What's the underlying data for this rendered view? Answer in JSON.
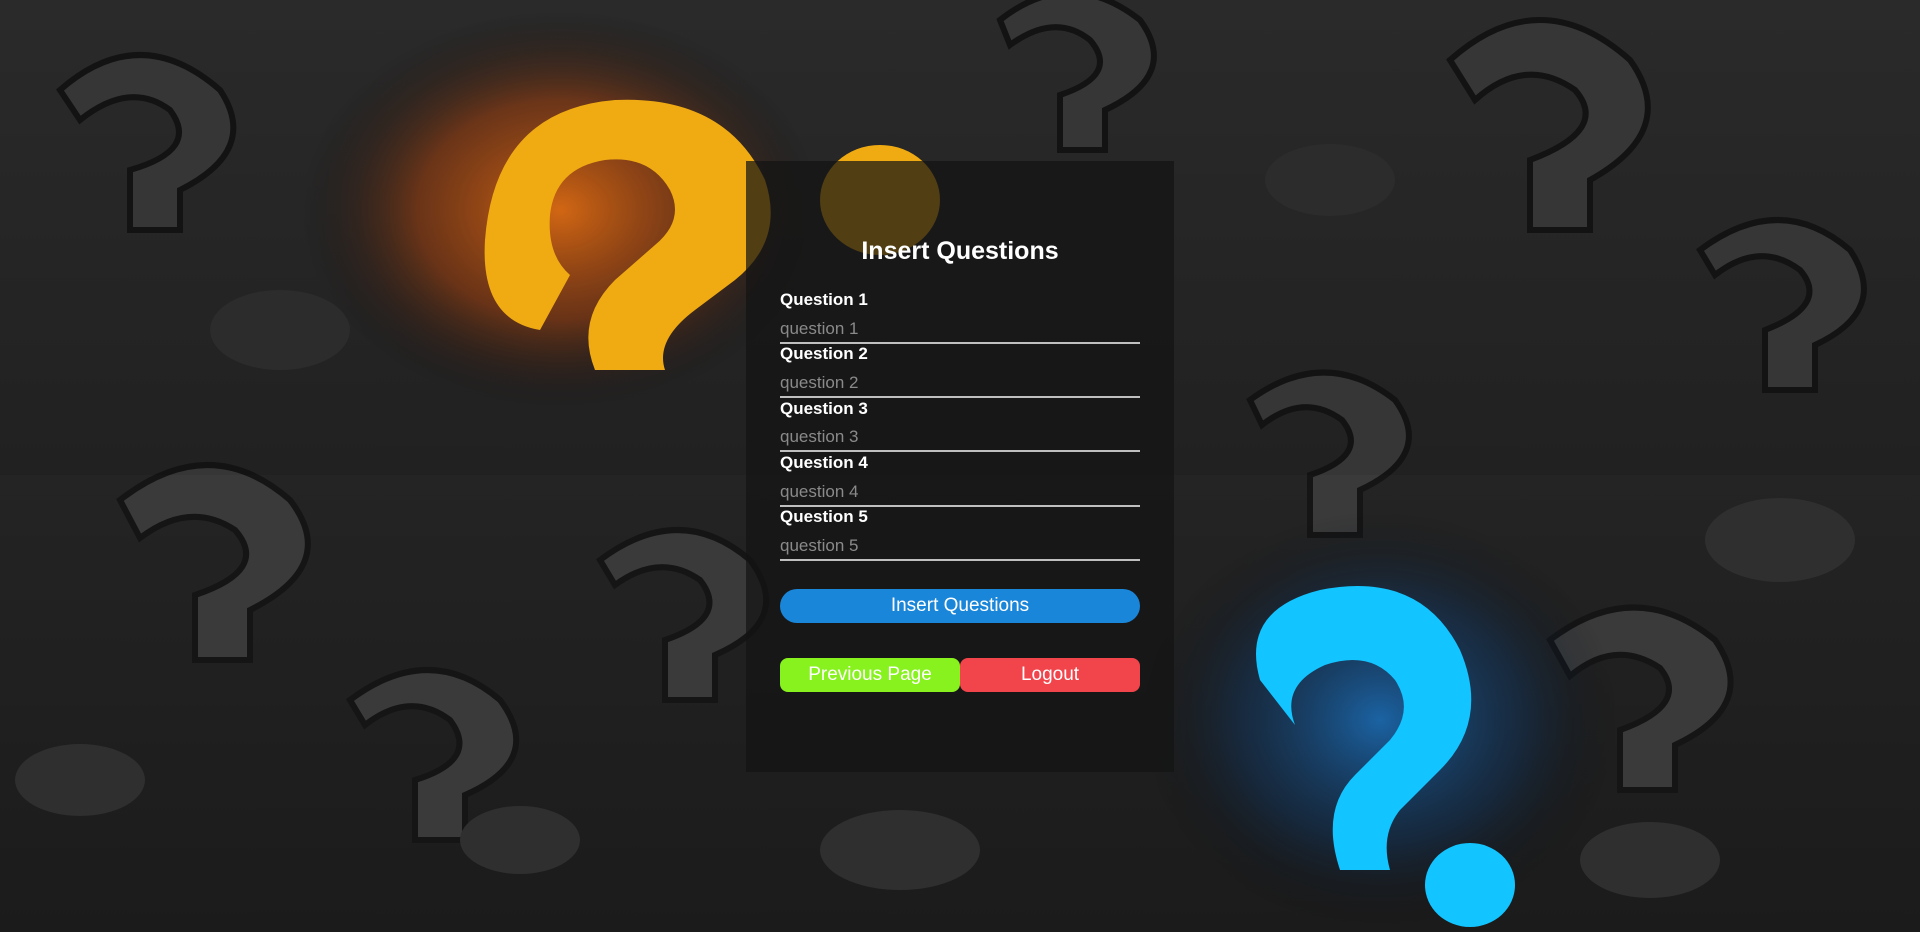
{
  "background": {
    "description_icon": "question-marks-background",
    "colors": {
      "base": "#262626",
      "orange_glow": "#ff7a12",
      "yellow_mark": "#ffb615",
      "blue_mark": "#12c4ff"
    }
  },
  "form": {
    "title": "Insert Questions",
    "questions": [
      {
        "label": "Question 1",
        "placeholder": "question 1"
      },
      {
        "label": "Question 2",
        "placeholder": "question 2"
      },
      {
        "label": "Question 3",
        "placeholder": "question 3"
      },
      {
        "label": "Question 4",
        "placeholder": "question 4"
      },
      {
        "label": "Question 5",
        "placeholder": "question 5"
      }
    ],
    "submit_label": "Insert Questions",
    "previous_label": "Previous Page",
    "logout_label": "Logout",
    "colors": {
      "submit": "#1a86d9",
      "previous": "#88f21f",
      "logout": "#f2454b"
    }
  }
}
